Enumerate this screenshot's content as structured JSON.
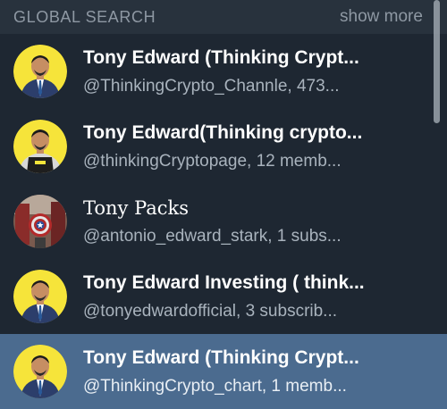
{
  "header": {
    "title": "GLOBAL SEARCH",
    "show_more_label": "show more"
  },
  "results": [
    {
      "name": "Tony Edward (Thinking Crypt...",
      "subtitle": "@ThinkingCrypto_Channle, 473...",
      "avatar": "suit-yellow",
      "selected": false
    },
    {
      "name": "Tony Edward(Thinking crypto...",
      "subtitle": "@thinkingCryptopage, 12 memb...",
      "avatar": "apron-yellow",
      "selected": false
    },
    {
      "name": "Tony Packs",
      "subtitle": "@antonio_edward_stark, 1 subs...",
      "avatar": "shield-photo",
      "selected": false
    },
    {
      "name": "Tony Edward Investing ( think...",
      "subtitle": "@tonyedwardofficial, 3 subscrib...",
      "avatar": "suit-yellow",
      "selected": false
    },
    {
      "name": "Tony Edward (Thinking Crypt...",
      "subtitle": "@ThinkingCrypto_chart, 1 memb...",
      "avatar": "suit-yellow",
      "selected": true
    }
  ],
  "colors": {
    "background": "#1e2732",
    "header_background": "#28323d",
    "selected_row": "#4b6b8f",
    "avatar_yellow": "#f6e43a"
  }
}
